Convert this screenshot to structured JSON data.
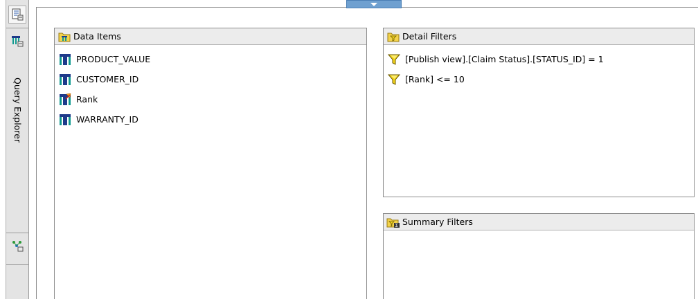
{
  "sidebar": {
    "label": "Query Explorer",
    "buttons": [
      {
        "icon": "report-page-icon"
      },
      {
        "icon": "query-list-icon"
      },
      {
        "icon": "query-tree-icon"
      }
    ]
  },
  "panels": {
    "data_items": {
      "title": "Data Items",
      "items": [
        {
          "label": "PRODUCT_VALUE",
          "icon": "data-item-icon"
        },
        {
          "label": "CUSTOMER_ID",
          "icon": "data-item-icon"
        },
        {
          "label": "Rank",
          "icon": "calculated-data-item-icon"
        },
        {
          "label": "WARRANTY_ID",
          "icon": "data-item-icon"
        }
      ]
    },
    "detail_filters": {
      "title": "Detail Filters",
      "items": [
        {
          "label": "[Publish view].[Claim Status].[STATUS_ID] = 1",
          "icon": "filter-icon"
        },
        {
          "label": "[Rank] <= 10",
          "icon": "filter-icon"
        }
      ]
    },
    "summary_filters": {
      "title": "Summary Filters",
      "items": []
    }
  },
  "colors": {
    "data_item_blue": "#1e3a8a",
    "data_item_teal": "#0f9a8f",
    "filter_yellow": "#f2d31a",
    "folder_yellow": "#f3d24a",
    "handle_blue": "#6fa0d0"
  }
}
